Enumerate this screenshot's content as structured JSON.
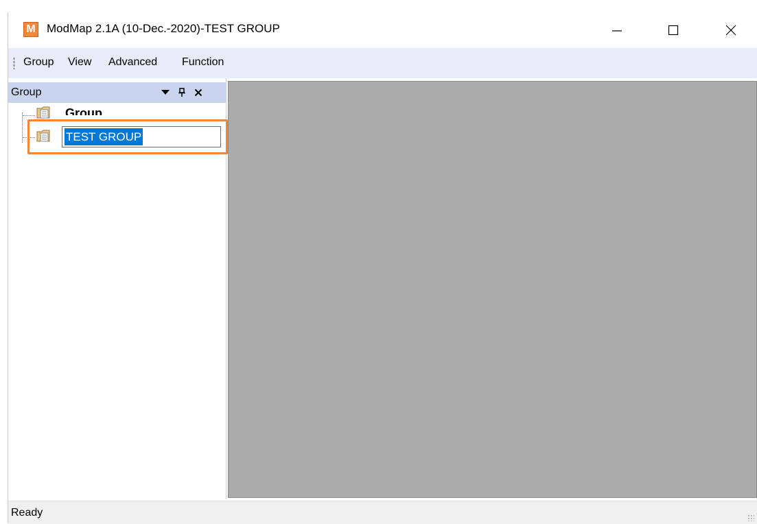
{
  "window": {
    "app_icon_letter": "M",
    "title": "ModMap 2.1A (10-Dec.-2020)-TEST GROUP"
  },
  "menu": {
    "items": [
      "Group",
      "View",
      "Advanced",
      "Function"
    ]
  },
  "panel": {
    "title": "Group",
    "tree": {
      "root_label": "Group",
      "editing_value": "TEST GROUP"
    }
  },
  "status": {
    "text": "Ready"
  },
  "colors": {
    "accent_highlight": "#f0883a",
    "selection": "#0078d7",
    "workspace": "#ababab",
    "menubar": "#e8ebf8",
    "panel_header": "#c9d5ef"
  },
  "icons": [
    "app-icon",
    "minimize-icon",
    "maximize-icon",
    "close-icon",
    "menu-grip-icon",
    "dropdown-arrow-icon",
    "pin-icon",
    "panel-close-icon",
    "folder-icon",
    "size-grip-icon"
  ]
}
